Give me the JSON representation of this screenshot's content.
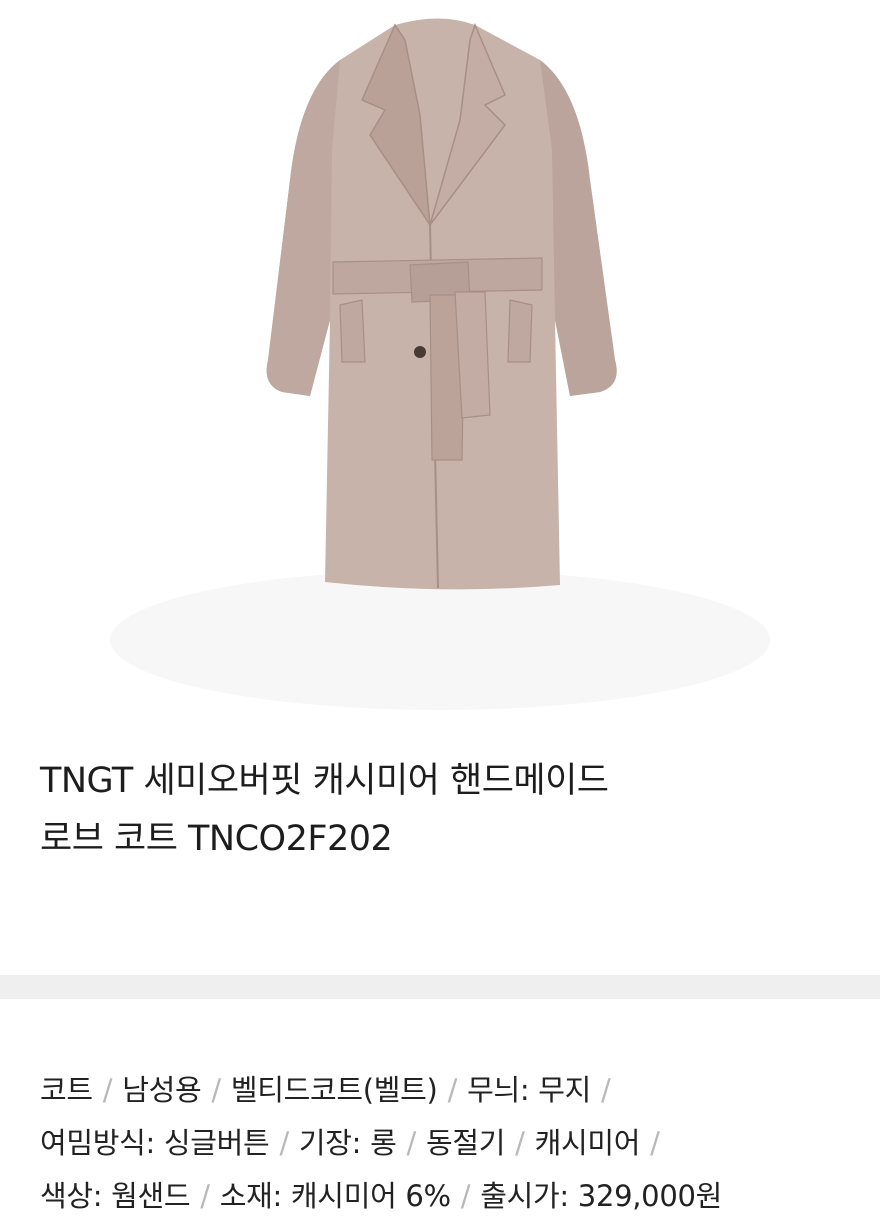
{
  "product": {
    "image_icon": "coat-photo",
    "title_line1": "TNGT 세미오버핏 캐시미어 핸드메이드",
    "title_line2": "로브 코트 TNCO2F202"
  },
  "attributes": [
    "코트",
    "남성용",
    "벨티드코트(벨트)",
    "무늬: 무지",
    "여밈방식: 싱글버튼",
    "기장: 롱",
    "동절기",
    "캐시미어",
    "색상: 웜샌드",
    "소재: 캐시미어 6%",
    "출시가: 329,000원"
  ],
  "separator": "/",
  "colors": {
    "coat": "#c8b3aa",
    "coat_shadow": "#a88f86",
    "divider": "#efefef",
    "separator": "#b9b9b9"
  }
}
